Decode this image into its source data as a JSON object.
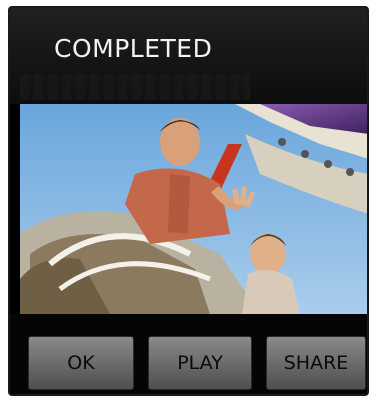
{
  "dialog": {
    "title": "COMPLETED"
  },
  "photo": {
    "description_icon": "photo-preview"
  },
  "buttons": {
    "ok_label": "OK",
    "play_label": "PLAY",
    "share_label": "SHARE"
  },
  "colors": {
    "background": "#000000",
    "title_text": "#f2f2f2",
    "button_top": "#8a8a8a",
    "button_bottom": "#4f4f4f",
    "sky": "#7fb3e0",
    "ride_red": "#c8351f",
    "ride_purple": "#6a3a8f"
  }
}
